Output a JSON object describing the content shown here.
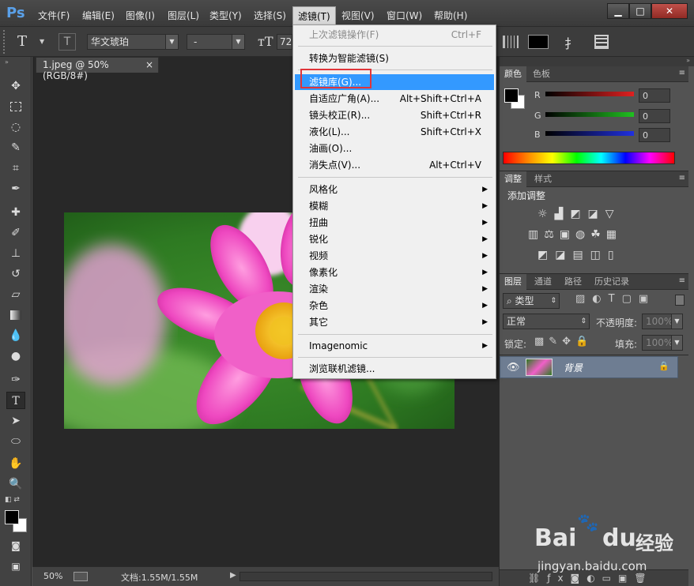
{
  "app": {
    "logo": "Ps"
  },
  "menubar": [
    "文件(F)",
    "编辑(E)",
    "图像(I)",
    "图层(L)",
    "类型(Y)",
    "选择(S)",
    "滤镜(T)",
    "视图(V)",
    "窗口(W)",
    "帮助(H)"
  ],
  "window_buttons": {
    "minimize": "▁",
    "maximize": "□",
    "close": "✕"
  },
  "options_bar": {
    "tool_glyph": "T",
    "font_family": "华文琥珀",
    "font_style": "-",
    "font_size_prefix": "72"
  },
  "document": {
    "tab_label": "1.jpeg @ 50%(RGB/8#)",
    "tab_close": "×"
  },
  "status": {
    "zoom": "50%",
    "doc_info": "文档:1.55M/1.55M"
  },
  "filter_menu": {
    "items": [
      {
        "label": "上次滤镜操作(F)",
        "shortcut": "Ctrl+F",
        "disabled": true
      },
      {
        "label": "转换为智能滤镜(S)",
        "shortcut": ""
      },
      {
        "label": "滤镜库(G)...",
        "shortcut": "",
        "highlighted": true
      },
      {
        "label": "自适应广角(A)...",
        "shortcut": "Alt+Shift+Ctrl+A"
      },
      {
        "label": "镜头校正(R)...",
        "shortcut": "Shift+Ctrl+R"
      },
      {
        "label": "液化(L)...",
        "shortcut": "Shift+Ctrl+X"
      },
      {
        "label": "油画(O)...",
        "shortcut": ""
      },
      {
        "label": "消失点(V)...",
        "shortcut": "Alt+Ctrl+V"
      },
      {
        "label": "风格化",
        "submenu": true
      },
      {
        "label": "模糊",
        "submenu": true
      },
      {
        "label": "扭曲",
        "submenu": true
      },
      {
        "label": "锐化",
        "submenu": true
      },
      {
        "label": "视频",
        "submenu": true
      },
      {
        "label": "像素化",
        "submenu": true
      },
      {
        "label": "渲染",
        "submenu": true
      },
      {
        "label": "杂色",
        "submenu": true
      },
      {
        "label": "其它",
        "submenu": true
      },
      {
        "label": "Imagenomic",
        "submenu": true
      },
      {
        "label": "浏览联机滤镜...",
        "shortcut": ""
      }
    ]
  },
  "color_panel": {
    "tabs": [
      "颜色",
      "色板"
    ],
    "channels": [
      {
        "name": "R",
        "value": "0",
        "color": "#e02020"
      },
      {
        "name": "G",
        "value": "0",
        "color": "#20c020"
      },
      {
        "name": "B",
        "value": "0",
        "color": "#2030e0"
      }
    ]
  },
  "adjust_panel": {
    "tabs": [
      "调整",
      "样式"
    ],
    "title": "添加调整"
  },
  "layers_panel": {
    "tabs": [
      "图层",
      "通道",
      "路径",
      "历史记录"
    ],
    "filter_kind": "类型",
    "blend_mode": "正常",
    "opacity_label": "不透明度:",
    "opacity_value": "100%",
    "lock_label": "锁定:",
    "fill_label": "填充:",
    "fill_value": "100%",
    "layer_name": "背景"
  },
  "watermark": {
    "brand": "Bai",
    "brand2": "du",
    "cn": "经验",
    "url": "jingyan.baidu.com"
  }
}
